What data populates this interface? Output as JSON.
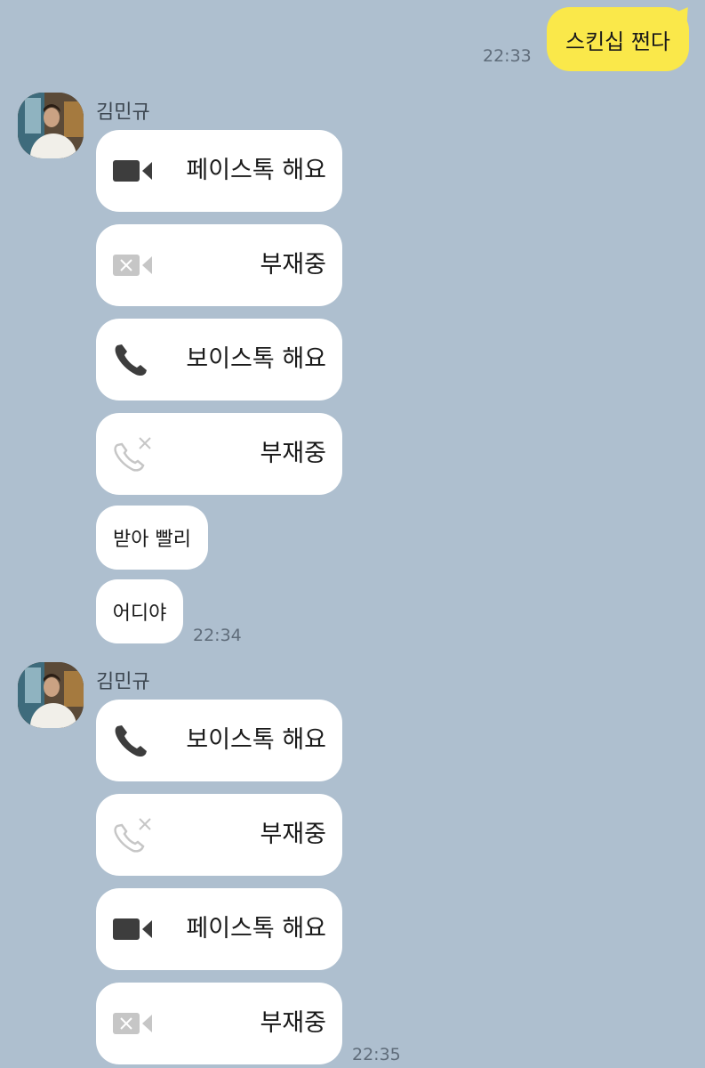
{
  "outgoing": {
    "text": "스킨십 쩐다",
    "time": "22:33"
  },
  "groups": [
    {
      "sender": "김민규",
      "calls": [
        {
          "icon": "video-camera-icon",
          "label": "페이스톡 해요"
        },
        {
          "icon": "missed-video-icon",
          "label": "부재중"
        },
        {
          "icon": "phone-icon",
          "label": "보이스톡 해요"
        },
        {
          "icon": "missed-phone-icon",
          "label": "부재중"
        }
      ],
      "messages": [
        "받아 빨리",
        "어디야"
      ],
      "time": "22:34"
    },
    {
      "sender": "김민규",
      "calls": [
        {
          "icon": "phone-icon",
          "label": "보이스톡 해요"
        },
        {
          "icon": "missed-phone-icon",
          "label": "부재중"
        },
        {
          "icon": "video-camera-icon",
          "label": "페이스톡 해요"
        },
        {
          "icon": "missed-video-icon",
          "label": "부재중"
        }
      ],
      "time": "22:35"
    }
  ],
  "colors": {
    "background": "#aebfcf",
    "outgoing_bubble": "#fae84a",
    "incoming_bubble": "#ffffff",
    "icon_active": "#3d3d3d",
    "icon_missed": "#c6c6c6"
  }
}
